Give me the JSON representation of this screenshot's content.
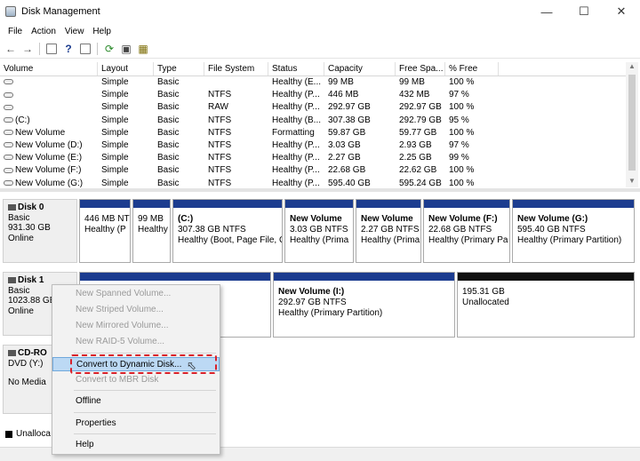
{
  "window": {
    "title": "Disk Management",
    "minimize": "—",
    "maximize": "☐",
    "close": "✕"
  },
  "menu": [
    "File",
    "Action",
    "View",
    "Help"
  ],
  "toolbar": {
    "icons": [
      "back-arrow-icon",
      "forward-arrow-icon",
      "properties-icon",
      "help-icon",
      "view-icon",
      "refresh-icon",
      "rescan-icon",
      "console-icon"
    ]
  },
  "volumes": {
    "columns": [
      "Volume",
      "Layout",
      "Type",
      "File System",
      "Status",
      "Capacity",
      "Free Spa...",
      "% Free"
    ],
    "rows": [
      [
        "",
        "Simple",
        "Basic",
        "",
        "Healthy (E...",
        "99 MB",
        "99 MB",
        "100 %"
      ],
      [
        "",
        "Simple",
        "Basic",
        "NTFS",
        "Healthy (P...",
        "446 MB",
        "432 MB",
        "97 %"
      ],
      [
        "",
        "Simple",
        "Basic",
        "RAW",
        "Healthy (P...",
        "292.97 GB",
        "292.97 GB",
        "100 %"
      ],
      [
        "(C:)",
        "Simple",
        "Basic",
        "NTFS",
        "Healthy (B...",
        "307.38 GB",
        "292.79 GB",
        "95 %"
      ],
      [
        "New Volume",
        "Simple",
        "Basic",
        "NTFS",
        "Formatting",
        "59.87 GB",
        "59.77 GB",
        "100 %"
      ],
      [
        "New Volume (D:)",
        "Simple",
        "Basic",
        "NTFS",
        "Healthy (P...",
        "3.03 GB",
        "2.93 GB",
        "97 %"
      ],
      [
        "New Volume (E:)",
        "Simple",
        "Basic",
        "NTFS",
        "Healthy (P...",
        "2.27 GB",
        "2.25 GB",
        "99 %"
      ],
      [
        "New Volume (F:)",
        "Simple",
        "Basic",
        "NTFS",
        "Healthy (P...",
        "22.68 GB",
        "22.62 GB",
        "100 %"
      ],
      [
        "New Volume (G:)",
        "Simple",
        "Basic",
        "NTFS",
        "Healthy (P...",
        "595.40 GB",
        "595.24 GB",
        "100 %"
      ]
    ]
  },
  "disk0": {
    "name": "Disk 0",
    "type": "Basic",
    "size": "931.30 GB",
    "status": "Online",
    "partitions": [
      {
        "name": "",
        "line1": "446 MB NT",
        "line2": "Healthy (P"
      },
      {
        "name": "",
        "line1": "99 MB",
        "line2": "Healthy"
      },
      {
        "name": "(C:)",
        "line1": "307.38 GB NTFS",
        "line2": "Healthy (Boot, Page File, C"
      },
      {
        "name": "New Volume",
        "line1": "3.03 GB NTFS",
        "line2": "Healthy (Prima"
      },
      {
        "name": "New Volume",
        "line1": "2.27 GB NTFS",
        "line2": "Healthy (Prima"
      },
      {
        "name": "New Volume  (F:)",
        "line1": "22.68 GB NTFS",
        "line2": "Healthy (Primary Pa"
      },
      {
        "name": "New Volume  (G:)",
        "line1": "595.40 GB NTFS",
        "line2": "Healthy (Primary Partition)"
      }
    ]
  },
  "disk1": {
    "name": "Disk 1",
    "type": "Basic",
    "size": "1023.88 GB",
    "status": "Online",
    "partitions": [
      {
        "name": "",
        "line1": "",
        "line2": ""
      },
      {
        "name": "New Volume  (I:)",
        "line1": "292.97 GB NTFS",
        "line2": "Healthy (Primary Partition)"
      },
      {
        "name": "",
        "line1": "195.31 GB",
        "line2": "Unallocated"
      }
    ]
  },
  "cdrom": {
    "name": "CD-RO",
    "drive": "DVD (Y:)",
    "status": "No Media"
  },
  "context_menu": {
    "items": [
      {
        "label": "New Spanned Volume...",
        "enabled": false
      },
      {
        "label": "New Striped Volume...",
        "enabled": false
      },
      {
        "label": "New Mirrored Volume...",
        "enabled": false
      },
      {
        "label": "New RAID-5 Volume...",
        "enabled": false
      },
      {
        "label": "Convert to Dynamic Disk...",
        "enabled": true,
        "highlighted": true
      },
      {
        "label": "Convert to MBR Disk",
        "enabled": false
      },
      {
        "label": "Offline",
        "enabled": true
      },
      {
        "label": "Properties",
        "enabled": true
      },
      {
        "label": "Help",
        "enabled": true
      }
    ]
  },
  "legend": {
    "unallocated": "Unalloca"
  },
  "colors": {
    "primary_bar": "#1c3c8f",
    "unallocated_bar": "#111111",
    "highlight_box": "#d8212a"
  }
}
